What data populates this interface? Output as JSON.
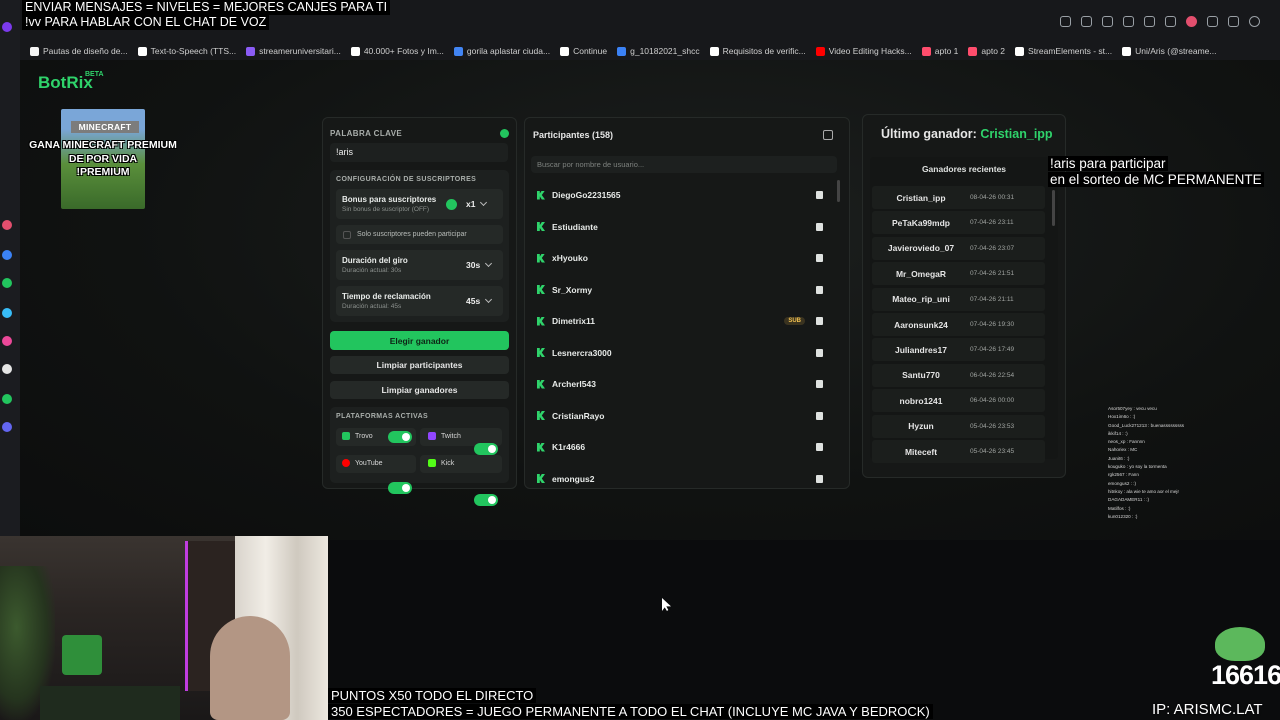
{
  "stream_overlays": {
    "top_lines": [
      "ENVIAR MENSAJES = NIVELES = MEJORES CANJES PARA TI",
      "!vv PARA HABLAR CON EL CHAT DE VOZ"
    ],
    "right_lines": [
      "!aris para participar",
      "en el sorteo de MC PERMANENTE"
    ],
    "bottom_lines": [
      "PUNTOS X50 TODO EL DIRECTO",
      "350 ESPECTADORES = JUEGO PERMANENTE A TODO EL CHAT (INCLUYE MC JAVA Y BEDROCK)"
    ],
    "ip": "IP: ARISMC.LAT",
    "counter": "16616",
    "minecraft_logo": "MINECRAFT",
    "minecraft_promo": [
      "GANA MINECRAFT PREMIUM",
      "DE POR VIDA",
      "!PREMIUM"
    ]
  },
  "bookmarks": [
    {
      "label": "Pautas de diseño de...",
      "color": "#f5f5f5"
    },
    {
      "label": "Text-to-Speech (TTS...",
      "color": "#ffffff"
    },
    {
      "label": "streameruniversitari...",
      "color": "#8b5cf6"
    },
    {
      "label": "40.000+ Fotos y Im...",
      "color": "#ffffff"
    },
    {
      "label": "gorila aplastar ciuda...",
      "color": "#4285f4"
    },
    {
      "label": "Continue",
      "color": "#ffffff"
    },
    {
      "label": "g_10182021_shcc",
      "color": "#3b82f6"
    },
    {
      "label": "Requisitos de verific...",
      "color": "#ffffff"
    },
    {
      "label": "Video Editing Hacks...",
      "color": "#ff0000"
    },
    {
      "label": "apto 1",
      "color": "#ff4d6d"
    },
    {
      "label": "apto 2",
      "color": "#ff4d6d"
    },
    {
      "label": "StreamElements - st...",
      "color": "#ffffff"
    },
    {
      "label": "Uni/Aris (@streame...",
      "color": "#ffffff"
    }
  ],
  "app": {
    "logo": "BotRix",
    "beta": "BETA",
    "keyword_label": "PALABRA CLAVE",
    "keyword_value": "!aris",
    "sub_config_label": "CONFIGURACIÓN DE SUSCRIPTORES",
    "sub_bonus_title": "Bonus para suscriptores",
    "sub_bonus_sub": "Sin bonus de suscriptor (OFF)",
    "sub_bonus_value": "x1",
    "subs_only_label": "Solo suscriptores pueden participar",
    "spin_title": "Duración del giro",
    "spin_sub": "Duración actual: 30s",
    "spin_value": "30s",
    "claim_title": "Tiempo de reclamación",
    "claim_sub": "Duración actual: 45s",
    "claim_value": "45s",
    "pick_winner": "Elegir ganador",
    "clear_participants": "Limpiar participantes",
    "clear_winners": "Limpiar ganadores",
    "platforms_label": "PLATAFORMAS ACTIVAS",
    "platforms": [
      {
        "name": "Trovo",
        "color": "#22c55e",
        "on": true
      },
      {
        "name": "Twitch",
        "color": "#9146ff",
        "on": true
      },
      {
        "name": "YouTube",
        "color": "#ff0000",
        "on": true
      },
      {
        "name": "Kick",
        "color": "#53fc18",
        "on": true
      }
    ],
    "participants_title": "Participantes (158)",
    "participants_search_placeholder": "Buscar por nombre de usuario...",
    "participants": [
      {
        "name": "DiegoGo2231565",
        "badge": ""
      },
      {
        "name": "Estiudiante",
        "badge": ""
      },
      {
        "name": "xHyouko",
        "badge": ""
      },
      {
        "name": "Sr_Xormy",
        "badge": ""
      },
      {
        "name": "Dimetrix11",
        "badge": "SUB"
      },
      {
        "name": "Lesnercra3000",
        "badge": ""
      },
      {
        "name": "Archerl543",
        "badge": ""
      },
      {
        "name": "CristianRayo",
        "badge": ""
      },
      {
        "name": "K1r4666",
        "badge": ""
      },
      {
        "name": "emongus2",
        "badge": ""
      }
    ],
    "last_winner_label": "Último ganador:",
    "last_winner_name": "Cristian_ipp",
    "recent_winners_label": "Ganadores recientes",
    "recent_winners": [
      {
        "name": "Cristian_ipp",
        "date": "08-04-26 00:31"
      },
      {
        "name": "PeTaKa99mdp",
        "date": "07-04-26 23:11"
      },
      {
        "name": "Javieroviedo_07",
        "date": "07-04-26 23:07"
      },
      {
        "name": "Mr_OmegaR",
        "date": "07-04-26 21:51"
      },
      {
        "name": "Mateo_rip_uni",
        "date": "07-04-26 21:11"
      },
      {
        "name": "Aaronsunk24",
        "date": "07-04-26 19:30"
      },
      {
        "name": "Juliandres17",
        "date": "07-04-26 17:49"
      },
      {
        "name": "Santu770",
        "date": "06-04-26 22:54"
      },
      {
        "name": "nobro1241",
        "date": "06-04-26 00:00"
      },
      {
        "name": "Hyzun",
        "date": "05-04-26 23:53"
      },
      {
        "name": "Miteceft",
        "date": "05-04-26 23:45"
      }
    ]
  },
  "chat": [
    "Asor507yey : vecu vecu",
    "Hox1im6o : :)",
    "Good_Luck271213 : buenasssssssss",
    "ikkif14 : :)",
    "neos_xp : Fannnn",
    "Nahoriex : MC",
    "Juanit6 : :)",
    "kouguko : yo soy la tormenta",
    "rgk2567 : Fann",
    "emongus2 : :)",
    "hitnkoy : ala wie te amo aor el mejr",
    "DAGADAMER11 : :)",
    "Matilfos : :)",
    "kun012320 : :)"
  ]
}
